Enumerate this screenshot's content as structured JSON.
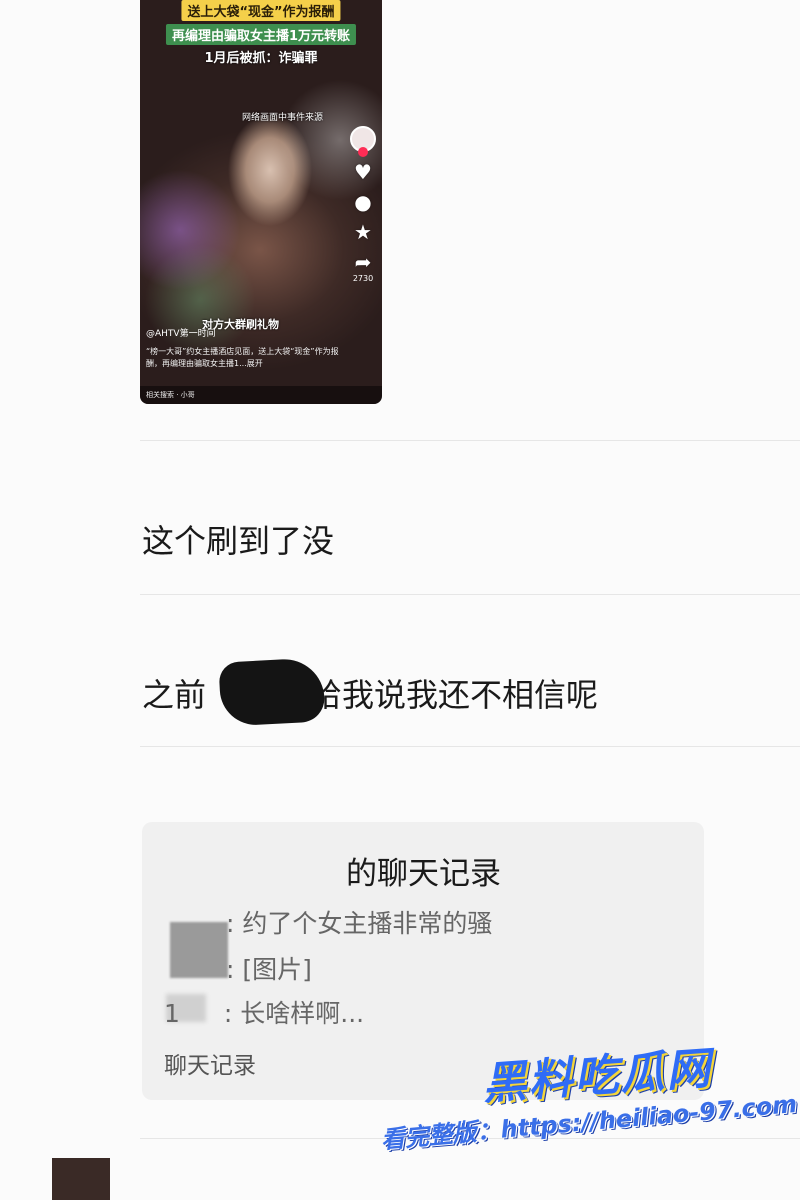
{
  "video": {
    "overlay_line1": "送上大袋“现金”作为报酬",
    "overlay_line2": "再编理由骗取女主播1万元转账",
    "overlay_line3": "1月后被抓：诈骗罪",
    "caption": "网络画面中事件来源",
    "gift_banner": "对方大群刷礼物",
    "author": "@AHTV第一时间",
    "description": "“榜一大哥”约女主播酒店见面，送上大袋“现金”作为报酬，再编理由骗取女主播1...展开",
    "related_search": "相关搜索 · 小哥",
    "share_count": "2730",
    "icons": [
      "avatar",
      "heart-icon",
      "comment-icon",
      "star-icon",
      "share-icon"
    ]
  },
  "messages": [
    {
      "text": "这个刷到了没"
    },
    {
      "text": "之前",
      "text_after": "给我说我还不相信呢"
    }
  ],
  "chat_card": {
    "title": "的聊天记录",
    "lines": [
      {
        "speaker": ":",
        "text": "约了个女主播非常的骚"
      },
      {
        "speaker": ":",
        "text": "[图片]"
      },
      {
        "speaker": "1",
        "text": ": 长啥样啊..."
      }
    ],
    "footer": "聊天记录"
  },
  "watermark": {
    "logo": "黑料吃瓜网",
    "url": "看完整版：https://heiliao-97.com"
  }
}
